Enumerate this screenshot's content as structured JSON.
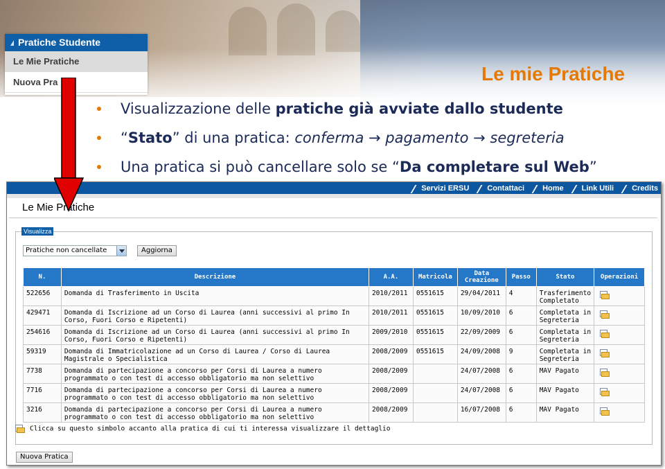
{
  "sidebar": {
    "header": "Pratiche Studente",
    "items": [
      {
        "label": "Le Mie Pratiche"
      },
      {
        "label": "Nuova Pra"
      }
    ]
  },
  "slide": {
    "title": "Le mie Pratiche",
    "bullet1": {
      "pre": "Visualizzazione delle ",
      "bold": "pratiche già avviate dallo studente"
    },
    "bullet2": {
      "q_open": "“",
      "bold": "Stato",
      "q_close": "”",
      "mid": " di una pratica: ",
      "s1": "conferma",
      "arrow1": " → ",
      "s2": "pagamento",
      "arrow2": " → ",
      "s3": "segreteria"
    },
    "bullet3": {
      "pre": "Una pratica si può cancellare solo se ",
      "q_open": "“",
      "bold": "Da completare sul Web",
      "q_close": "”"
    }
  },
  "topnav": {
    "links": [
      "Servizi ERSU",
      "Contattaci",
      "Home",
      "Link Utili",
      "Credits"
    ]
  },
  "page": {
    "title": "Le Mie Pratiche",
    "legend": "Visualizza",
    "filter_value": "Pratiche non cancellate",
    "refresh_label": "Aggiorna",
    "hint": "Clicca su questo simbolo accanto alla pratica di cui ti interessa visualizzare il dettaglio",
    "new_label": "Nuova Pratica"
  },
  "table": {
    "headers": [
      "N.",
      "Descrizione",
      "A.A.",
      "Matricola",
      "Data Creazione",
      "Passo",
      "Stato",
      "Operazioni"
    ],
    "rows": [
      {
        "n": "522656",
        "desc": "Domanda di Trasferimento in Uscita",
        "aa": "2010/2011",
        "matricola": "0551615",
        "data": "29/04/2011",
        "passo": "4",
        "stato": "Trasferimento Completato"
      },
      {
        "n": "429471",
        "desc": "Domanda di Iscrizione ad un Corso di Laurea (anni successivi al primo In Corso, Fuori Corso e Ripetenti)",
        "aa": "2010/2011",
        "matricola": "0551615",
        "data": "10/09/2010",
        "passo": "6",
        "stato": "Completata in Segreteria"
      },
      {
        "n": "254616",
        "desc": "Domanda di Iscrizione ad un Corso di Laurea (anni successivi al primo In Corso, Fuori Corso e Ripetenti)",
        "aa": "2009/2010",
        "matricola": "0551615",
        "data": "22/09/2009",
        "passo": "6",
        "stato": "Completata in Segreteria"
      },
      {
        "n": "59319",
        "desc": "Domanda di Immatricolazione ad un Corso di Laurea / Corso di Laurea Magistrale o Specialistica",
        "aa": "2008/2009",
        "matricola": "0551615",
        "data": "24/09/2008",
        "passo": "9",
        "stato": "Completata in Segreteria"
      },
      {
        "n": "7738",
        "desc": "Domanda di partecipazione a concorso per Corsi di Laurea a numero programmato o con test di accesso obbligatorio ma non selettivo",
        "aa": "2008/2009",
        "matricola": "",
        "data": "24/07/2008",
        "passo": "6",
        "stato": "MAV Pagato"
      },
      {
        "n": "7716",
        "desc": "Domanda di partecipazione a concorso per Corsi di Laurea a numero programmato o con test di accesso obbligatorio ma non selettivo",
        "aa": "2008/2009",
        "matricola": "",
        "data": "24/07/2008",
        "passo": "6",
        "stato": "MAV Pagato"
      },
      {
        "n": "3216",
        "desc": "Domanda di partecipazione a concorso per Corsi di Laurea a numero programmato o con test di accesso obbligatorio ma non selettivo",
        "aa": "2008/2009",
        "matricola": "",
        "data": "16/07/2008",
        "passo": "6",
        "stato": "MAV Pagato"
      }
    ],
    "row_icon": "folder-doc-icon"
  },
  "colors": {
    "accent": "#e47a05",
    "header_blue": "#2578c8",
    "nav_blue": "#0d57a0",
    "bullet_text": "#1b2a57",
    "arrow_red": "#e00000"
  }
}
